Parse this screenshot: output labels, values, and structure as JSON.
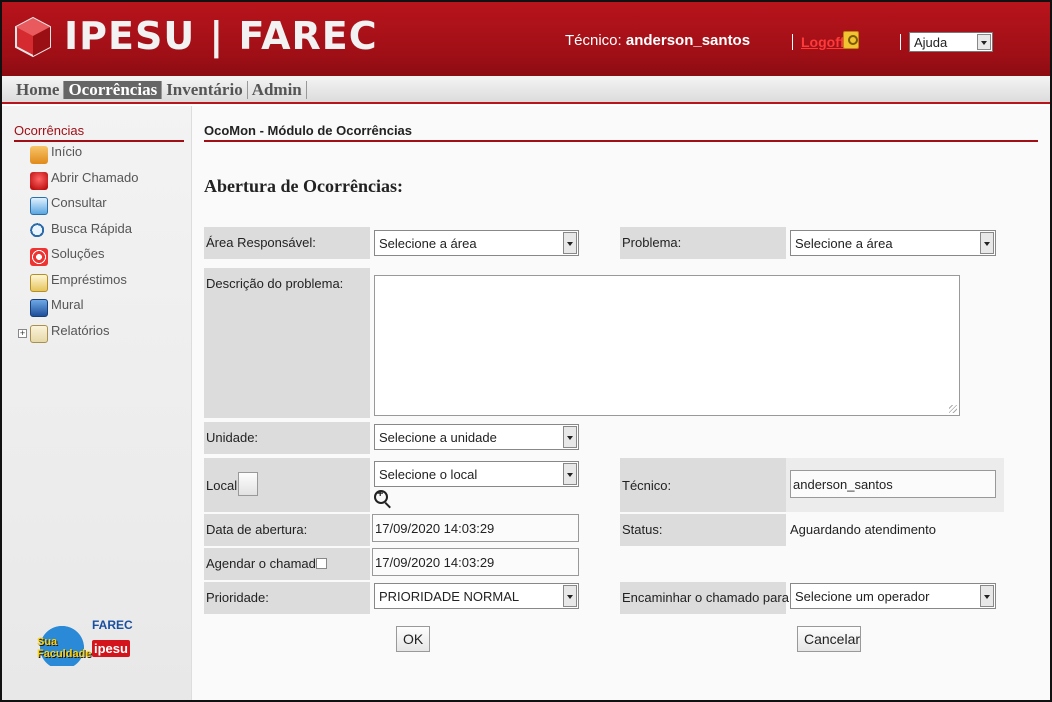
{
  "header": {
    "logo_text": "IPESU | FAREC",
    "tecnico_prefix": "Técnico: ",
    "tecnico_user": "anderson_santos",
    "logoff": "Logoff",
    "ajuda": "Ajuda"
  },
  "nav": {
    "items": [
      "Home",
      "Ocorrências",
      "Inventário",
      "Admin"
    ],
    "active": "Ocorrências"
  },
  "sidebar": {
    "title": "Ocorrências",
    "items": [
      {
        "label": "Início",
        "icon": "home-icon"
      },
      {
        "label": "Abrir Chamado",
        "icon": "lifebuoy-icon"
      },
      {
        "label": "Consultar",
        "icon": "window-icon"
      },
      {
        "label": "Busca Rápida",
        "icon": "magnifier-icon"
      },
      {
        "label": "Soluções",
        "icon": "target-icon"
      },
      {
        "label": "Empréstimos",
        "icon": "document-icon"
      },
      {
        "label": "Mural",
        "icon": "board-icon"
      },
      {
        "label": "Relatórios",
        "icon": "folder-icon"
      }
    ],
    "logos": {
      "sua_faculdade": "Sua Faculdade",
      "farec": "FAREC",
      "ipesu": "ipesu"
    }
  },
  "main": {
    "title": "OcoMon - Módulo de Ocorrências",
    "heading": "Abertura de Ocorrências:",
    "form": {
      "area_label": "Área Responsável:",
      "area_value": "Selecione a área",
      "problema_label": "Problema:",
      "problema_value": "Selecione a área",
      "descricao_label": "Descrição do problema:",
      "unidade_label": "Unidade:",
      "unidade_value": "Selecione a unidade",
      "local_label": "Local:",
      "local_value": "Selecione o local",
      "tecnico_label": "Técnico:",
      "tecnico_value": "anderson_santos",
      "data_label": "Data de abertura:",
      "data_value": "17/09/2020 14:03:29",
      "status_label": "Status:",
      "status_value": "Aguardando atendimento",
      "agendar_label": "Agendar o chamado:",
      "agendar_value": "17/09/2020 14:03:29",
      "prioridade_label": "Prioridade:",
      "prioridade_value": "PRIORIDADE NORMAL",
      "encaminhar_label": "Encaminhar o chamado para:",
      "encaminhar_value": "Selecione um operador",
      "ok_label": "OK",
      "cancel_label": "Cancelar"
    }
  },
  "colors": {
    "brand_red": "#a00f16",
    "logoff_red": "#ff3a3a"
  }
}
